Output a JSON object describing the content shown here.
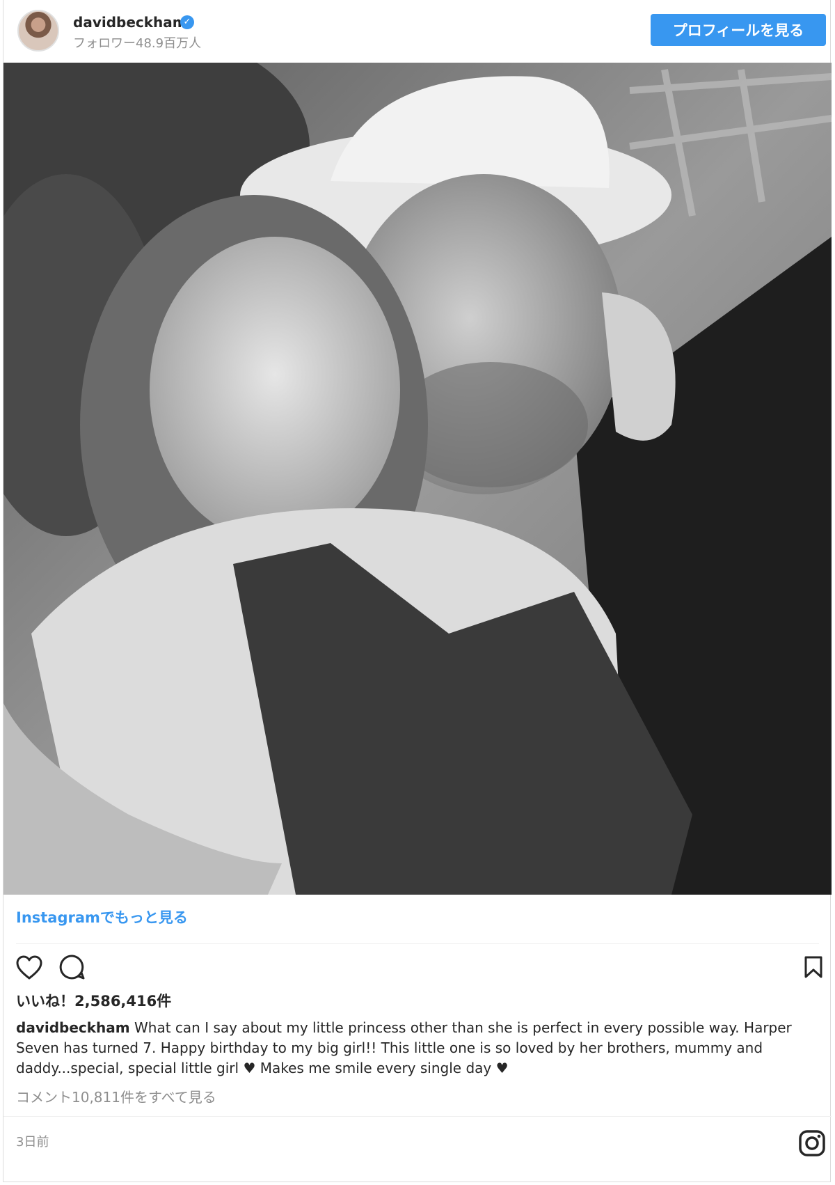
{
  "post": {
    "username": "davidbeckham",
    "followers": "フォロワー48.9百万人",
    "profile_button": "プロフィールを見る",
    "more_link": "Instagramでもっと見る",
    "likes": "いいね！2,586,416件",
    "caption_user": "davidbeckham",
    "caption_text": " What can I say about my little princess other than she is perfect in every possible way. Harper Seven has turned 7. Happy birthday to my big girl!! This little one is so loved by her brothers, mummy and daddy...special, special little girl ♥ Makes me smile every single day ♥",
    "view_comments": "コメント10,811件をすべて見る",
    "timestamp": "3日前"
  },
  "icons": {
    "verified": "verified-badge-icon",
    "like": "heart-icon",
    "comment": "comment-icon",
    "save": "bookmark-icon",
    "brand": "instagram-icon"
  },
  "colors": {
    "accent": "#3897f0",
    "muted": "#8e8e8e",
    "text": "#262626"
  }
}
